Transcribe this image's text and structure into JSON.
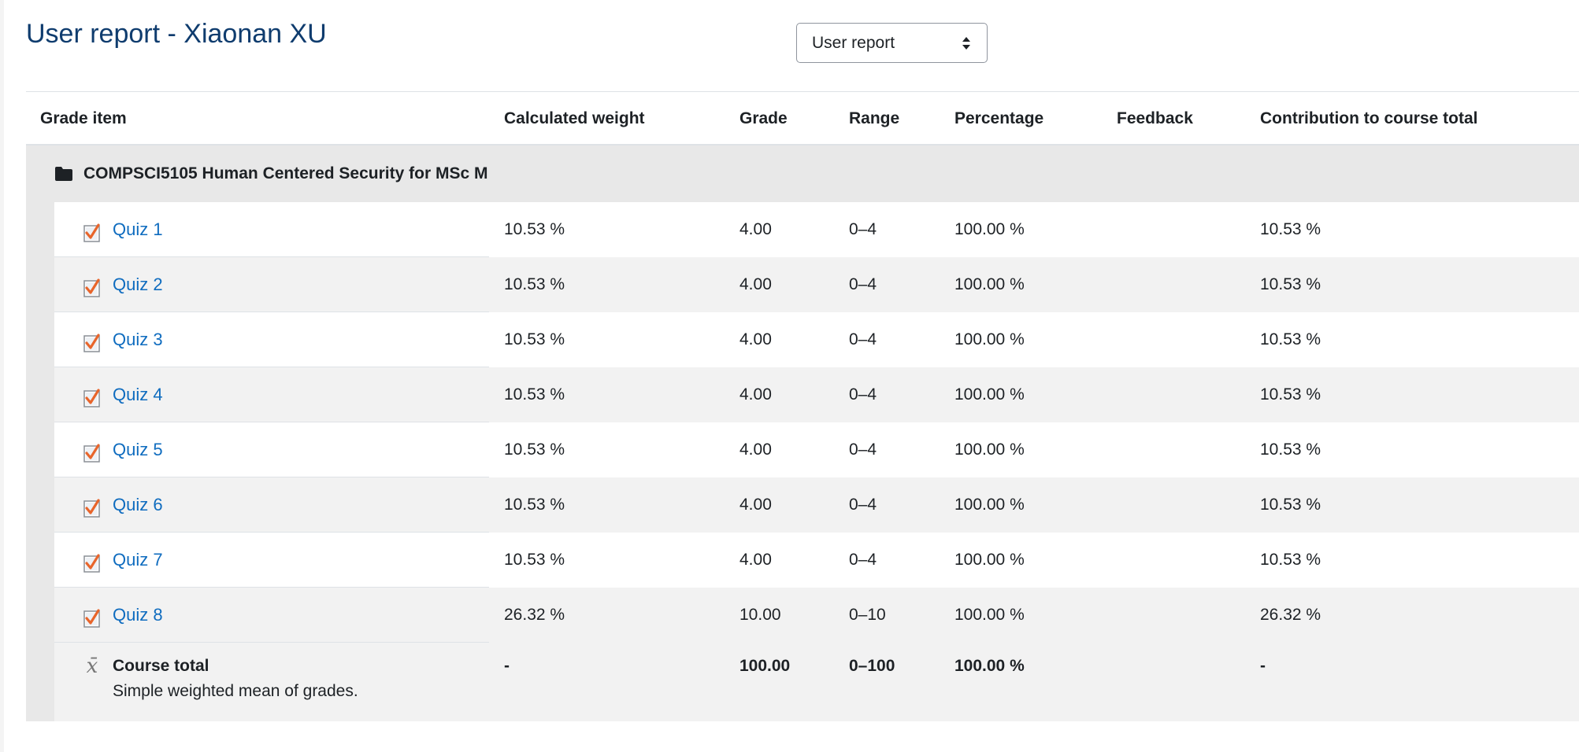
{
  "page": {
    "title": "User report - Xiaonan XU"
  },
  "report_selector": {
    "selected": "User report"
  },
  "table": {
    "columns": {
      "grade_item": "Grade item",
      "calculated_weight": "Calculated weight",
      "grade": "Grade",
      "range": "Range",
      "percentage": "Percentage",
      "feedback": "Feedback",
      "contribution": "Contribution to course total"
    },
    "category": {
      "name": "COMPSCI5105 Human Centered Security for MSc M",
      "icon": "folder-icon"
    },
    "rows": [
      {
        "name": "Quiz 1",
        "weight": "10.53 %",
        "grade": "4.00",
        "range": "0–4",
        "percentage": "100.00 %",
        "feedback": "",
        "contribution": "10.53 %"
      },
      {
        "name": "Quiz 2",
        "weight": "10.53 %",
        "grade": "4.00",
        "range": "0–4",
        "percentage": "100.00 %",
        "feedback": "",
        "contribution": "10.53 %"
      },
      {
        "name": "Quiz 3",
        "weight": "10.53 %",
        "grade": "4.00",
        "range": "0–4",
        "percentage": "100.00 %",
        "feedback": "",
        "contribution": "10.53 %"
      },
      {
        "name": "Quiz 4",
        "weight": "10.53 %",
        "grade": "4.00",
        "range": "0–4",
        "percentage": "100.00 %",
        "feedback": "",
        "contribution": "10.53 %"
      },
      {
        "name": "Quiz 5",
        "weight": "10.53 %",
        "grade": "4.00",
        "range": "0–4",
        "percentage": "100.00 %",
        "feedback": "",
        "contribution": "10.53 %"
      },
      {
        "name": "Quiz 6",
        "weight": "10.53 %",
        "grade": "4.00",
        "range": "0–4",
        "percentage": "100.00 %",
        "feedback": "",
        "contribution": "10.53 %"
      },
      {
        "name": "Quiz 7",
        "weight": "10.53 %",
        "grade": "4.00",
        "range": "0–4",
        "percentage": "100.00 %",
        "feedback": "",
        "contribution": "10.53 %"
      },
      {
        "name": "Quiz 8",
        "weight": "26.32 %",
        "grade": "10.00",
        "range": "0–10",
        "percentage": "100.00 %",
        "feedback": "",
        "contribution": "26.32 %"
      }
    ],
    "total": {
      "label": "Course total",
      "description": "Simple weighted mean of grades.",
      "weight": "-",
      "grade": "100.00",
      "range": "0–100",
      "percentage": "100.00 %",
      "contribution": "-",
      "icon": "mean-x-bar-icon"
    }
  },
  "colors": {
    "title": "#0f3c6e",
    "link": "#0f6cbf",
    "quiz_check": "#e8652b"
  }
}
